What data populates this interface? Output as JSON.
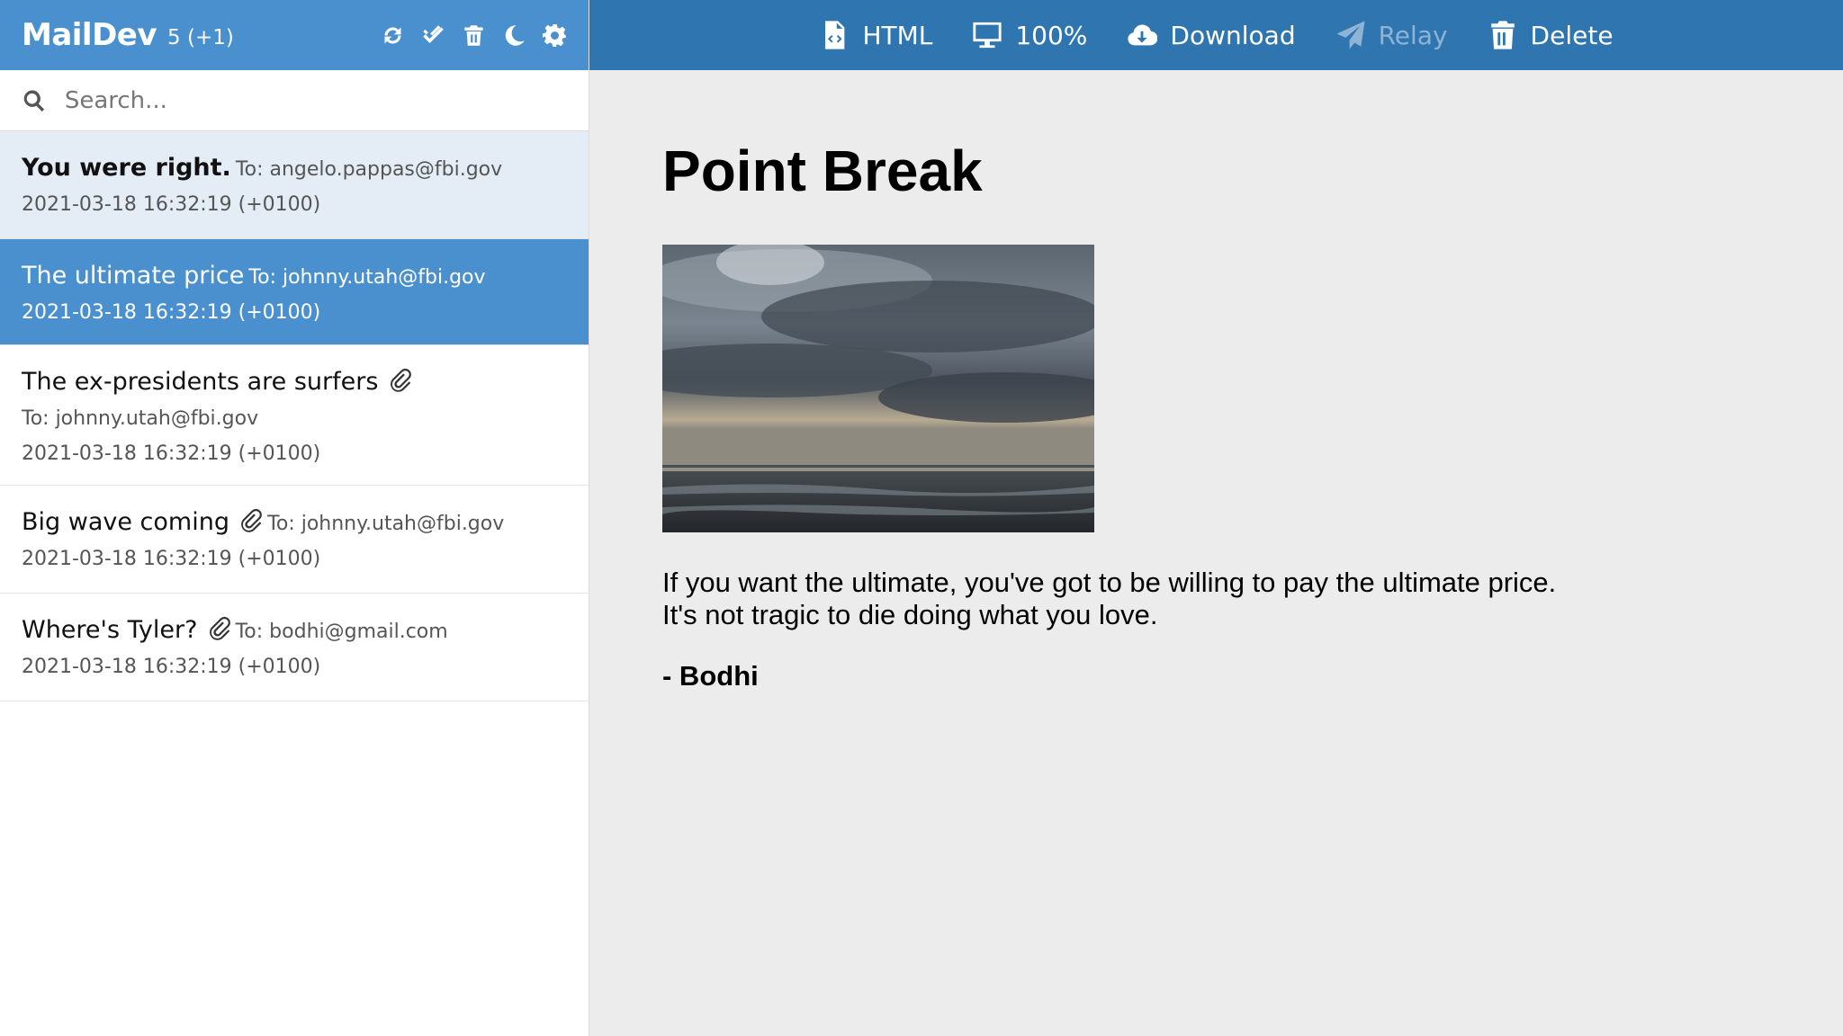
{
  "app": {
    "title": "MailDev",
    "count": "5 (+1)"
  },
  "sidebar_tools": [
    "refresh-icon",
    "mark-read-icon",
    "trash-icon",
    "moon-icon",
    "gear-icon"
  ],
  "search": {
    "placeholder": "Search..."
  },
  "emails": [
    {
      "subject": "You were right.",
      "to": "To: angelo.pappas@fbi.gov",
      "date": "2021-03-18 16:32:19 (+0100)",
      "attachment": false,
      "state": "read"
    },
    {
      "subject": "The ultimate price",
      "to": "To: johnny.utah@fbi.gov",
      "date": "2021-03-18 16:32:19 (+0100)",
      "attachment": false,
      "state": "selected"
    },
    {
      "subject": "The ex-presidents are surfers",
      "to": "To: johnny.utah@fbi.gov",
      "date": "2021-03-18 16:32:19 (+0100)",
      "attachment": true,
      "state": "normal"
    },
    {
      "subject": "Big wave coming",
      "to": "To: johnny.utah@fbi.gov",
      "date": "2021-03-18 16:32:19 (+0100)",
      "attachment": true,
      "state": "normal"
    },
    {
      "subject": "Where's Tyler?",
      "to": "To: bodhi@gmail.com",
      "date": "2021-03-18 16:32:19 (+0100)",
      "attachment": true,
      "state": "normal"
    }
  ],
  "toolbar": {
    "html_label": "HTML",
    "zoom_label": "100%",
    "download_label": "Download",
    "relay_label": "Relay",
    "delete_label": "Delete"
  },
  "message": {
    "heading": "Point Break",
    "line1": "If you want the ultimate, you've got to be willing to pay the ultimate price.",
    "line2": "It's not tragic to die doing what you love.",
    "signature": "- Bodhi"
  },
  "colors": {
    "sidebar_header": "#4a90cf",
    "topbar": "#2f76b0",
    "selected_row": "#4a90cf",
    "read_row": "#e4edf6",
    "content_bg": "#ececec"
  }
}
